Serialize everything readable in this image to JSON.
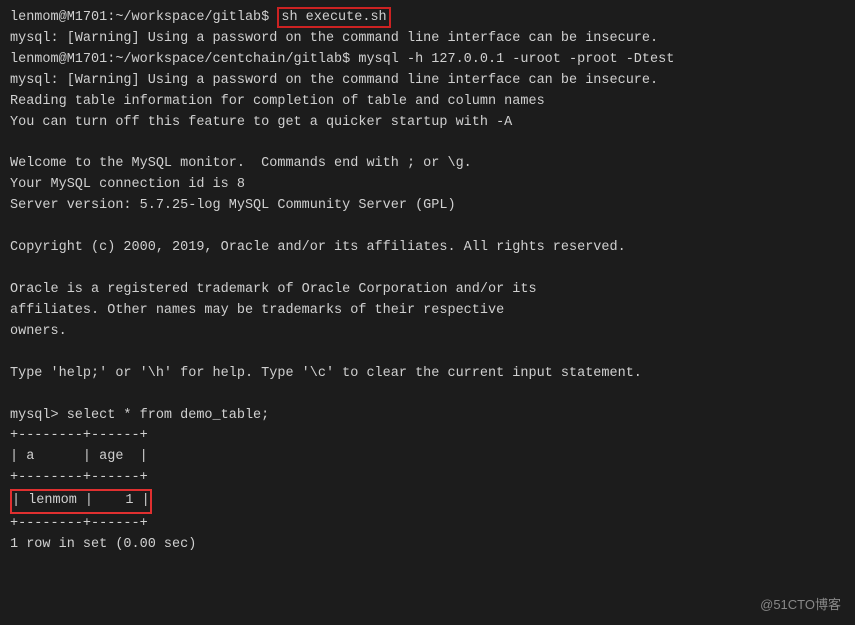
{
  "terminal": {
    "lines": [
      {
        "id": "l1",
        "text": "lenmom@M1701:~/workspace/gitlab$ sh execute.sh",
        "highlight_command": true,
        "prompt_end": 33,
        "command": "sh execute.sh"
      },
      {
        "id": "l2",
        "text": "mysql: [Warning] Using a password on the command line interface can be insecure."
      },
      {
        "id": "l3",
        "text": "lenmom@M1701:~/workspace/centchain/gitlab$ mysql -h 127.0.0.1 -uroot -proot -Dtest"
      },
      {
        "id": "l4",
        "text": "mysql: [Warning] Using a password on the command line interface can be insecure."
      },
      {
        "id": "l5",
        "text": "Reading table information for completion of table and column names"
      },
      {
        "id": "l6",
        "text": "You can turn off this feature to get a quicker startup with -A"
      },
      {
        "id": "l7",
        "text": ""
      },
      {
        "id": "l8",
        "text": "Welcome to the MySQL monitor.  Commands end with ; or \\g."
      },
      {
        "id": "l9",
        "text": "Your MySQL connection id is 8"
      },
      {
        "id": "l10",
        "text": "Server version: 5.7.25-log MySQL Server (GPL)"
      },
      {
        "id": "l11",
        "text": ""
      },
      {
        "id": "l12",
        "text": "Copyright (c) 2000, 2019, Oracle and/or its affiliates. All rights reserved."
      },
      {
        "id": "l13",
        "text": ""
      },
      {
        "id": "l14",
        "text": "Oracle is a registered trademark of Oracle Corporation and/or its"
      },
      {
        "id": "l15",
        "text": "affiliates. Other names may be trademarks of their respective"
      },
      {
        "id": "l16",
        "text": "owners."
      },
      {
        "id": "l17",
        "text": ""
      },
      {
        "id": "l18",
        "text": "Type 'help;' or '\\h' for help. Type '\\c' to clear the current input statement."
      },
      {
        "id": "l19",
        "text": ""
      },
      {
        "id": "l20",
        "text": "mysql> select * from demo_table;"
      },
      {
        "id": "l21",
        "text": "+--------+------+"
      },
      {
        "id": "l22",
        "text": "| a      | age  |"
      },
      {
        "id": "l23",
        "text": "+--------+------+"
      },
      {
        "id": "l24",
        "text": "| lenmom |    1 |",
        "highlight_row": true
      },
      {
        "id": "l25",
        "text": "+--------+------+"
      },
      {
        "id": "l26",
        "text": "1 row in set (0.00 sec)"
      }
    ],
    "watermark": "@51CTO博客"
  }
}
